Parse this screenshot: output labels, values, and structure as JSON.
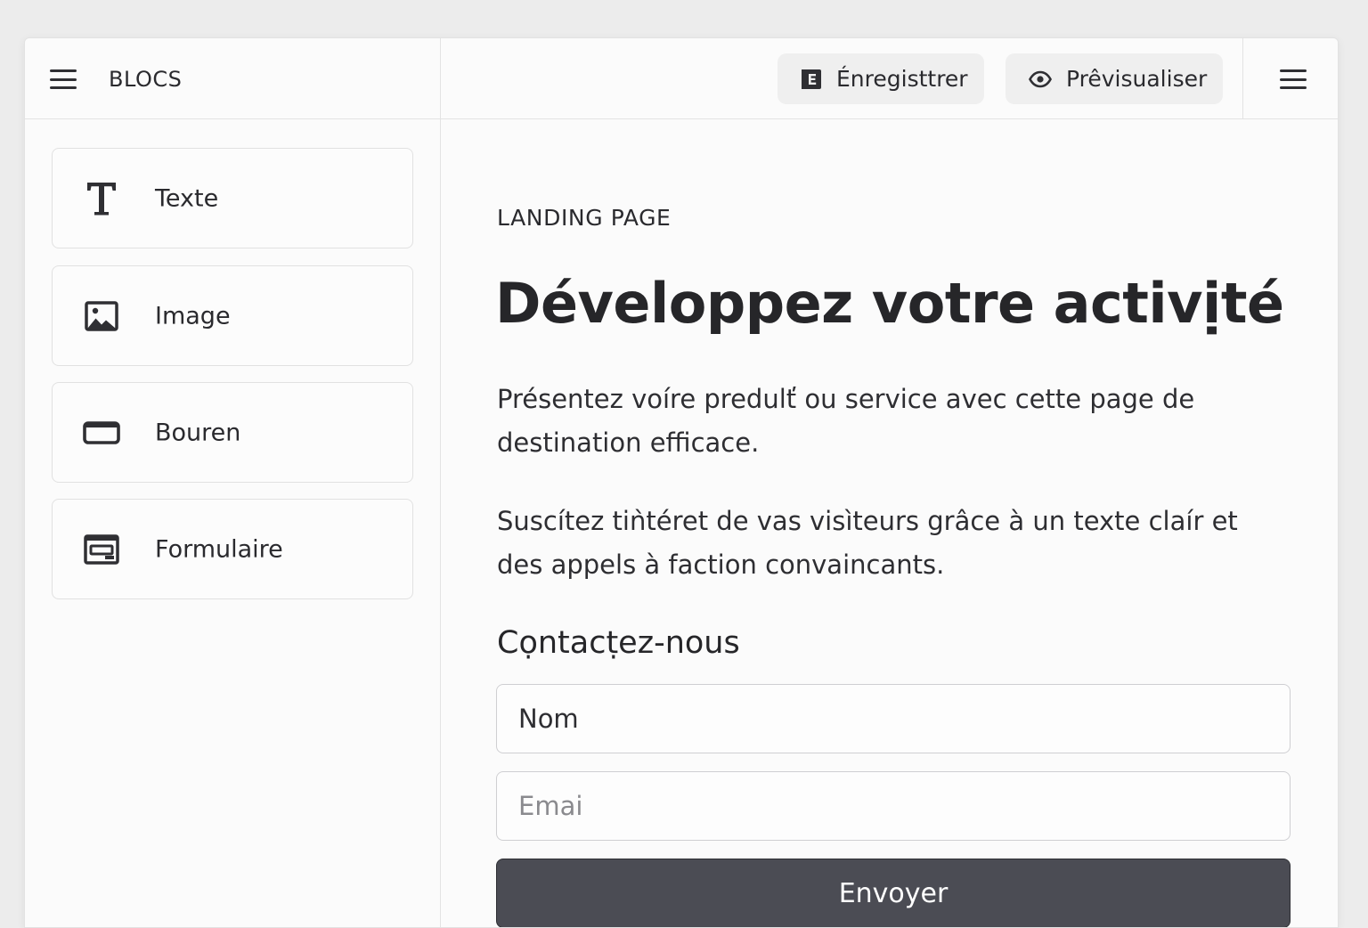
{
  "header": {
    "sidebar_title": "BLOCS",
    "save_label": "Énregisttrer",
    "preview_label": "Prêvisualiser"
  },
  "sidebar": {
    "blocks": [
      {
        "label": "Texte",
        "icon": "text-icon"
      },
      {
        "label": "Image",
        "icon": "image-icon"
      },
      {
        "label": "Bouren",
        "icon": "button-icon"
      },
      {
        "label": "Formulaire",
        "icon": "form-icon"
      }
    ]
  },
  "page": {
    "eyebrow": "LANDING PAGE",
    "headline": "Développez votre activịté",
    "paragraph1": "Présentez voíre predulť ou service avec cette page de destination efficace.",
    "paragraph2": "Suscítez tiǹtéret de vas visìteurs grâce à un texte claír et des appels à faction convaincants.",
    "contact_title": "Cọntacṭez-nous",
    "form": {
      "name_placeholder": "Nom",
      "email_placeholder": "Emai",
      "submit_label": "Envoyer"
    }
  },
  "colors": {
    "accent_button": "#4b4c54",
    "background": "#fbfbfb",
    "text": "#2a2a2e"
  }
}
